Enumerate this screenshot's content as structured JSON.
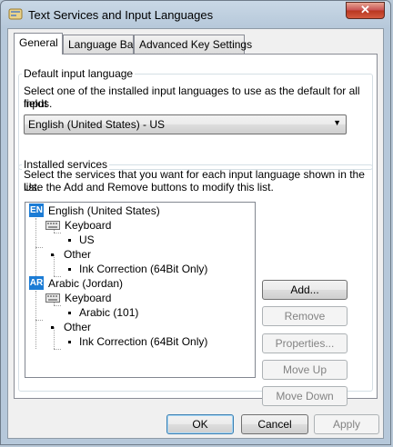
{
  "window": {
    "title": "Text Services and Input Languages",
    "close_glyph": "✕"
  },
  "tabs": [
    {
      "label": "General",
      "active": true
    },
    {
      "label": "Language Bar",
      "active": false
    },
    {
      "label": "Advanced Key Settings",
      "active": false
    }
  ],
  "default_input": {
    "group_label": "Default input language",
    "description_line1": "Select one of the installed input languages to use as the default for all input",
    "description_line2": "fields.",
    "selected": "English (United States) - US"
  },
  "installed_services": {
    "group_label": "Installed services",
    "description_line1": "Select the services that you want for each input language shown in the list.",
    "description_line2": "Use the Add and Remove buttons to modify this list.",
    "tree": [
      {
        "badge": "EN",
        "label": "English (United States)"
      },
      {
        "label": "Keyboard"
      },
      {
        "label": "US"
      },
      {
        "label": "Other"
      },
      {
        "label": "Ink Correction (64Bit Only)"
      },
      {
        "badge": "AR",
        "label": "Arabic (Jordan)"
      },
      {
        "label": "Keyboard"
      },
      {
        "label": "Arabic (101)"
      },
      {
        "label": "Other"
      },
      {
        "label": "Ink Correction (64Bit Only)"
      }
    ],
    "buttons": {
      "add": "Add...",
      "remove": "Remove",
      "properties": "Properties...",
      "move_up": "Move Up",
      "move_down": "Move Down"
    }
  },
  "footer": {
    "ok": "OK",
    "cancel": "Cancel",
    "apply": "Apply"
  },
  "colors": {
    "badge_blue": "#1c7cd5",
    "close_red": "#c75050"
  }
}
